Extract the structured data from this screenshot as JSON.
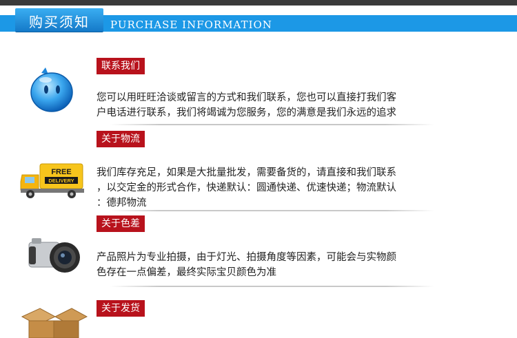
{
  "header": {
    "title_cn": "购买须知",
    "title_en": "PURCHASE INFORMATION",
    "band_color": "#1c98e6",
    "tab_color": "#1479c8"
  },
  "sections": [
    {
      "label": "联系我们",
      "icon": "wangwang-chat-icon",
      "lines": [
        "您可以用旺旺洽谈或留言的方式和我们联系，您也可以直接打我们客",
        "户电话进行联系，我们将竭诚为您服务，您的满意是我们永远的追求"
      ]
    },
    {
      "label": "关于物流",
      "icon": "delivery-truck-icon",
      "truck_sign": [
        "FREE",
        "DELIVERY"
      ],
      "lines": [
        "我们库存充足，如果是大批量批发，需要备货的，请直接和我们联系",
        "，以交定金的形式合作，快递默认：圆通快递、优速快递；物流默认",
        "：德邦物流"
      ]
    },
    {
      "label": "关于色差",
      "icon": "camera-icon",
      "lines": [
        "产品照片为专业拍摄，由于灯光、拍摄角度等因素，可能会与实物颜",
        "色存在一点偏差，最终实际宝贝颜色为准"
      ]
    },
    {
      "label": "关于发货",
      "icon": "shipping-box-icon",
      "lines": []
    }
  ],
  "colors": {
    "label_bg": "#b8121c",
    "text": "#222222"
  }
}
